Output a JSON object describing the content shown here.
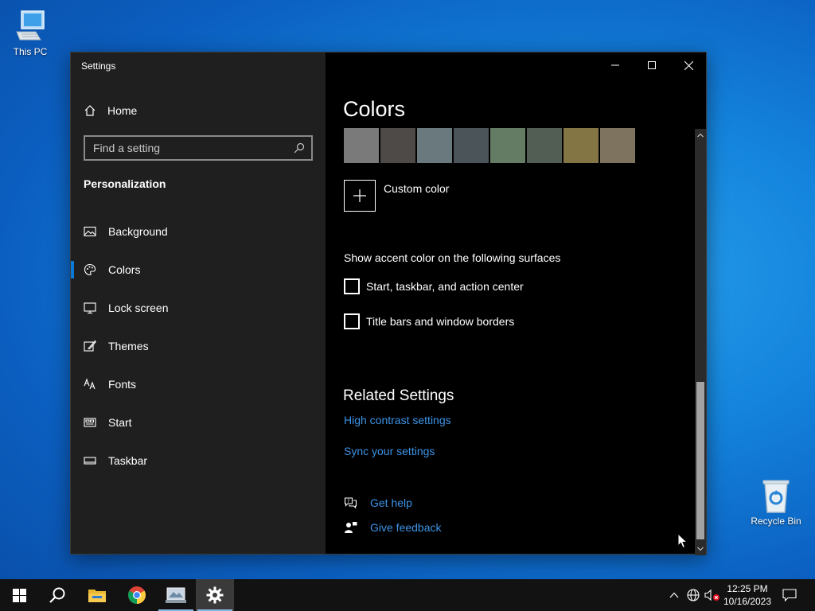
{
  "desktop": {
    "this_pc_label": "This PC",
    "recycle_bin_label": "Recycle Bin"
  },
  "window": {
    "title": "Settings",
    "controls": [
      "minimize",
      "maximize",
      "close"
    ]
  },
  "sidebar": {
    "home_label": "Home",
    "search_placeholder": "Find a setting",
    "section_heading": "Personalization",
    "items": [
      {
        "label": "Background",
        "icon": "image-icon",
        "active": false
      },
      {
        "label": "Colors",
        "icon": "palette-icon",
        "active": true
      },
      {
        "label": "Lock screen",
        "icon": "monitor-icon",
        "active": false
      },
      {
        "label": "Themes",
        "icon": "brush-icon",
        "active": false
      },
      {
        "label": "Fonts",
        "icon": "font-icon",
        "active": false
      },
      {
        "label": "Start",
        "icon": "start-icon",
        "active": false
      },
      {
        "label": "Taskbar",
        "icon": "taskbar-icon",
        "active": false
      }
    ]
  },
  "content": {
    "page_title": "Colors",
    "swatch_colors": [
      "#7a7a7a",
      "#4d4a48",
      "#69797e",
      "#4a5459",
      "#647c64",
      "#525e54",
      "#847545",
      "#7e735f"
    ],
    "custom_color_label": "Custom color",
    "surfaces_label": "Show accent color on the following surfaces",
    "checkboxes": [
      {
        "label": "Start, taskbar, and action center",
        "checked": false
      },
      {
        "label": "Title bars and window borders",
        "checked": false
      }
    ],
    "related_title": "Related Settings",
    "links": [
      "High contrast settings",
      "Sync your settings"
    ],
    "help": {
      "get_help": "Get help",
      "give_feedback": "Give feedback"
    }
  },
  "taskbar": {
    "apps": [
      "start-icon",
      "search-icon",
      "file-explorer-icon",
      "chrome-icon",
      "app-icon",
      "settings-icon"
    ],
    "time": "12:25 PM",
    "date": "10/16/2023"
  },
  "colors": {
    "accent": "#0a78d7",
    "link": "#3c93e6",
    "sidebar_bg": "#1f1f1f",
    "content_bg": "#000000"
  }
}
